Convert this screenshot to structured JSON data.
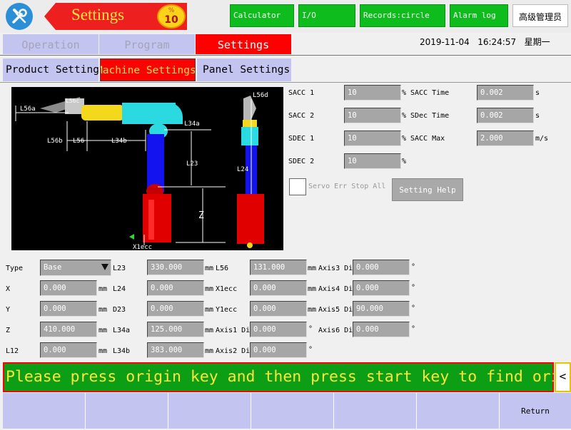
{
  "header": {
    "title": "Settings",
    "badge_number": "10",
    "buttons": {
      "calculator": "Calculator",
      "io": "I/O",
      "records": "Records:circle",
      "alarm": "Alarm log"
    },
    "user": "高级管理员",
    "date": "2019-11-04",
    "time": "16:24:57",
    "weekday": "星期一"
  },
  "main_tabs": [
    "Operation",
    "Program",
    "Settings"
  ],
  "sub_tabs": [
    "Product Settings",
    "Machine Settings",
    "Panel Settings"
  ],
  "diagram": {
    "labels": {
      "L56a": "L56a",
      "L56c": "L56c",
      "L56b": "L56b",
      "L56": "L56",
      "L34b": "L34b",
      "L34a": "L34a",
      "L23": "L23",
      "Z": "Z",
      "X1ecc": "X1ecc",
      "L56d": "L56d",
      "L24": "L24"
    }
  },
  "accel": {
    "rows": [
      {
        "label": "SACC 1",
        "value": "10",
        "unit": "%",
        "label2": "SACC Time",
        "value2": "0.002",
        "unit2": "s"
      },
      {
        "label": "SACC 2",
        "value": "10",
        "unit": "%",
        "label2": "SDec Time",
        "value2": "0.002",
        "unit2": "s"
      },
      {
        "label": "SDEC 1",
        "value": "10",
        "unit": "%",
        "label2": "SACC Max",
        "value2": "2.000",
        "unit2": "m/s"
      },
      {
        "label": "SDEC 2",
        "value": "10",
        "unit": "%"
      }
    ],
    "servo_label": "Servo Err Stop All",
    "help_button": "Setting Help"
  },
  "params": {
    "col1": [
      {
        "label": "Type",
        "value": "Base",
        "unit": ""
      },
      {
        "label": "X",
        "value": "0.000",
        "unit": "mm"
      },
      {
        "label": "Y",
        "value": "0.000",
        "unit": "mm"
      },
      {
        "label": "Z",
        "value": "410.000",
        "unit": "mm"
      },
      {
        "label": "L12",
        "value": "0.000",
        "unit": "mm"
      }
    ],
    "col2": [
      {
        "label": "L23",
        "value": "330.000",
        "unit": "mm"
      },
      {
        "label": "L24",
        "value": "0.000",
        "unit": "mm"
      },
      {
        "label": "D23",
        "value": "0.000",
        "unit": "mm"
      },
      {
        "label": "L34a",
        "value": "125.000",
        "unit": "mm"
      },
      {
        "label": "L34b",
        "value": "383.000",
        "unit": "mm"
      }
    ],
    "col3": [
      {
        "label": "L56",
        "value": "131.000",
        "unit": "mm"
      },
      {
        "label": "X1ecc",
        "value": "0.000",
        "unit": "mm"
      },
      {
        "label": "Y1ecc",
        "value": "0.000",
        "unit": "mm"
      },
      {
        "label": "Axis1 Di",
        "value": "0.000",
        "unit": "°"
      },
      {
        "label": "Axis2 Di",
        "value": "0.000",
        "unit": "°"
      }
    ],
    "col4": [
      {
        "label": "Axis3 Di",
        "value": "0.000",
        "unit": "°"
      },
      {
        "label": "Axis4 Di",
        "value": "0.000",
        "unit": "°"
      },
      {
        "label": "Axis5 Di",
        "value": "90.000",
        "unit": "°"
      },
      {
        "label": "Axis6 Di",
        "value": "0.000",
        "unit": "°"
      }
    ]
  },
  "message": "Please press origin key and then press start key to find origin",
  "message_arrow": "<",
  "bottom_buttons": [
    "",
    "",
    "",
    "",
    "",
    "",
    "Return"
  ],
  "colors": {
    "accent_red": "#ff0000",
    "green": "#0fbc1d",
    "tab_inactive": "#c4c4f0",
    "field_gray": "#a6a6a6"
  }
}
